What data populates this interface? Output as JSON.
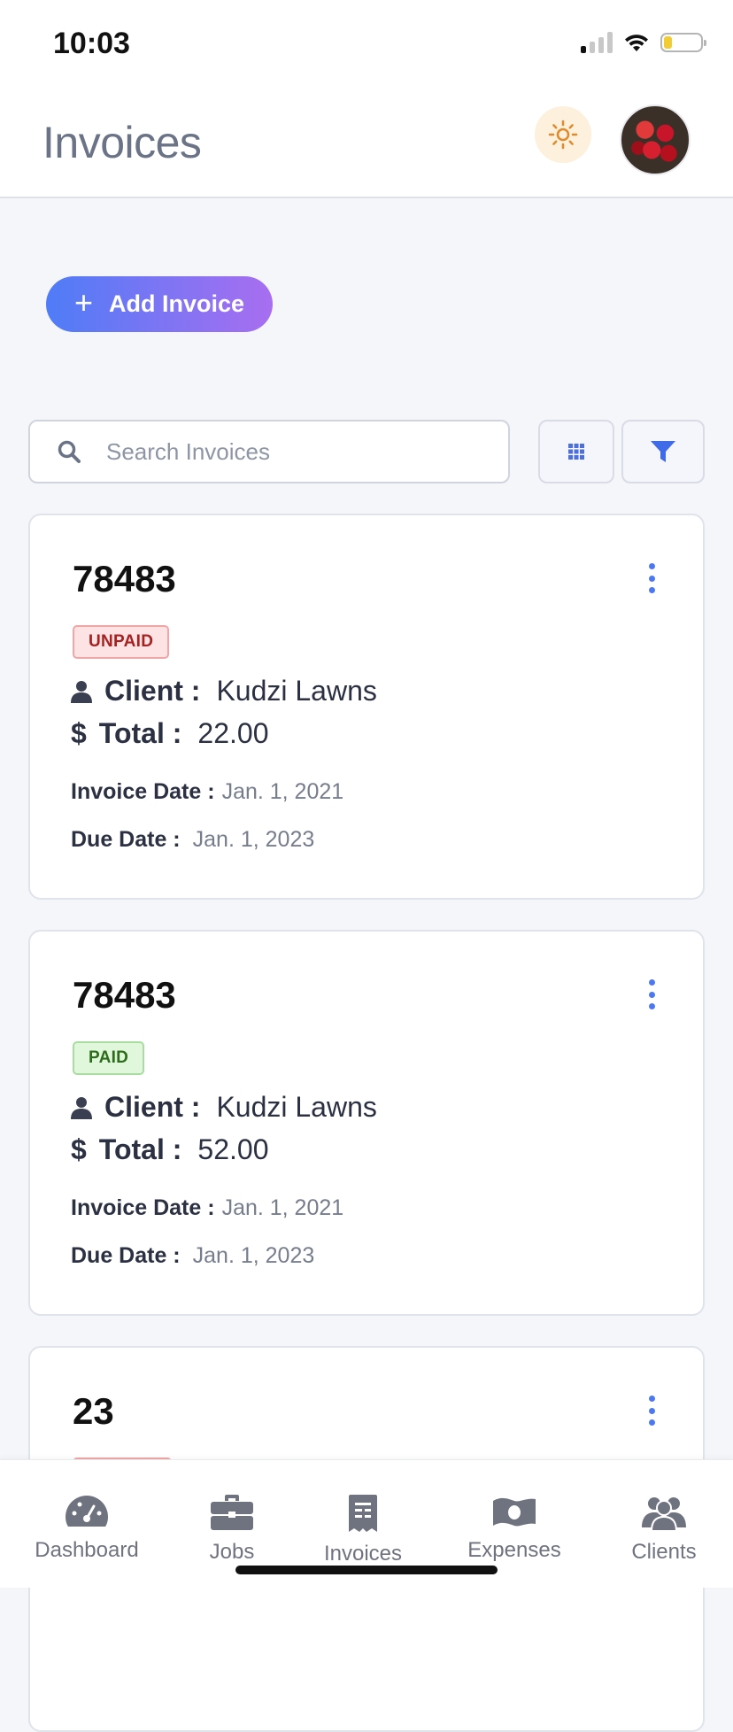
{
  "status_bar": {
    "time": "10:03"
  },
  "header": {
    "title": "Invoices"
  },
  "actions": {
    "add_invoice_label": "Add Invoice"
  },
  "search": {
    "placeholder": "Search Invoices"
  },
  "invoices": [
    {
      "number": "78483",
      "status": "UNPAID",
      "client_label": "Client :",
      "client": "Kudzi Lawns",
      "total_label": "Total :",
      "total": "22.00",
      "invoice_date_label": "Invoice Date :",
      "invoice_date": "Jan. 1, 2021",
      "due_date_label": "Due Date :",
      "due_date": "Jan. 1, 2023"
    },
    {
      "number": "78483",
      "status": "PAID",
      "client_label": "Client :",
      "client": "Kudzi Lawns",
      "total_label": "Total :",
      "total": "52.00",
      "invoice_date_label": "Invoice Date :",
      "invoice_date": "Jan. 1, 2021",
      "due_date_label": "Due Date :",
      "due_date": "Jan. 1, 2023"
    },
    {
      "number": "23"
    }
  ],
  "bottom_nav": [
    {
      "label": "Dashboard",
      "icon": "gauge-icon"
    },
    {
      "label": "Jobs",
      "icon": "briefcase-icon"
    },
    {
      "label": "Invoices",
      "icon": "receipt-icon"
    },
    {
      "label": "Expenses",
      "icon": "money-icon"
    },
    {
      "label": "Clients",
      "icon": "users-icon"
    }
  ],
  "colors": {
    "accent_start": "#4f7cf7",
    "accent_end": "#a86ef0",
    "unpaid": "#a62222",
    "paid": "#2c6d1c",
    "kebab": "#4d78f0"
  }
}
